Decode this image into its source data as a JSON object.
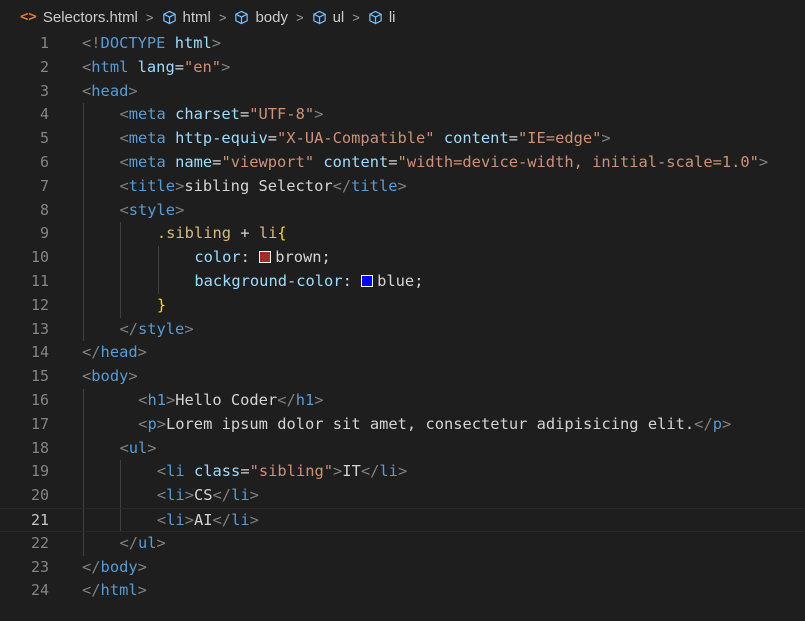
{
  "breadcrumb": {
    "file": "Selectors.html",
    "items": [
      "html",
      "body",
      "ul",
      "li"
    ]
  },
  "editor": {
    "current_line": 21,
    "lines": [
      {
        "n": "1",
        "indent": 0,
        "tokens": [
          [
            "br",
            "<!"
          ],
          [
            "tag",
            "DOCTYPE"
          ],
          [
            "txt",
            " "
          ],
          [
            "attr",
            "html"
          ],
          [
            "br",
            ">"
          ]
        ]
      },
      {
        "n": "2",
        "indent": 0,
        "tokens": [
          [
            "br",
            "<"
          ],
          [
            "tag",
            "html"
          ],
          [
            "txt",
            " "
          ],
          [
            "attr",
            "lang"
          ],
          [
            "txt",
            "="
          ],
          [
            "str",
            "\"en\""
          ],
          [
            "br",
            ">"
          ]
        ]
      },
      {
        "n": "3",
        "indent": 0,
        "tokens": [
          [
            "br",
            "<"
          ],
          [
            "tag",
            "head"
          ],
          [
            "br",
            ">"
          ]
        ]
      },
      {
        "n": "4",
        "indent": 1,
        "tokens": [
          [
            "br",
            "<"
          ],
          [
            "tag",
            "meta"
          ],
          [
            "txt",
            " "
          ],
          [
            "attr",
            "charset"
          ],
          [
            "txt",
            "="
          ],
          [
            "str",
            "\"UTF-8\""
          ],
          [
            "br",
            ">"
          ]
        ]
      },
      {
        "n": "5",
        "indent": 1,
        "tokens": [
          [
            "br",
            "<"
          ],
          [
            "tag",
            "meta"
          ],
          [
            "txt",
            " "
          ],
          [
            "attr",
            "http-equiv"
          ],
          [
            "txt",
            "="
          ],
          [
            "str",
            "\"X-UA-Compatible\""
          ],
          [
            "txt",
            " "
          ],
          [
            "attr",
            "content"
          ],
          [
            "txt",
            "="
          ],
          [
            "str",
            "\"IE=edge\""
          ],
          [
            "br",
            ">"
          ]
        ]
      },
      {
        "n": "6",
        "indent": 1,
        "tokens": [
          [
            "br",
            "<"
          ],
          [
            "tag",
            "meta"
          ],
          [
            "txt",
            " "
          ],
          [
            "attr",
            "name"
          ],
          [
            "txt",
            "="
          ],
          [
            "str",
            "\"viewport\""
          ],
          [
            "txt",
            " "
          ],
          [
            "attr",
            "content"
          ],
          [
            "txt",
            "="
          ],
          [
            "str",
            "\"width=device-width, initial-scale=1.0\""
          ],
          [
            "br",
            ">"
          ]
        ]
      },
      {
        "n": "7",
        "indent": 1,
        "tokens": [
          [
            "br",
            "<"
          ],
          [
            "tag",
            "title"
          ],
          [
            "br",
            ">"
          ],
          [
            "txt",
            "sibling Selector"
          ],
          [
            "br",
            "</"
          ],
          [
            "tag",
            "title"
          ],
          [
            "br",
            ">"
          ]
        ]
      },
      {
        "n": "8",
        "indent": 1,
        "tokens": [
          [
            "br",
            "<"
          ],
          [
            "tag",
            "style"
          ],
          [
            "br",
            ">"
          ]
        ]
      },
      {
        "n": "9",
        "indent": 2,
        "tokens": [
          [
            "sel",
            ".sibling"
          ],
          [
            "txt",
            " + "
          ],
          [
            "sel",
            "li"
          ],
          [
            "brace",
            "{"
          ]
        ]
      },
      {
        "n": "10",
        "indent": 3,
        "tokens": [
          [
            "prop",
            "color"
          ],
          [
            "txt",
            ": "
          ],
          [
            "swatch",
            "#a52a2a"
          ],
          [
            "txt",
            "brown;"
          ]
        ]
      },
      {
        "n": "11",
        "indent": 3,
        "tokens": [
          [
            "prop",
            "background-color"
          ],
          [
            "txt",
            ": "
          ],
          [
            "swatch",
            "#0000ff"
          ],
          [
            "txt",
            "blue;"
          ]
        ]
      },
      {
        "n": "12",
        "indent": 2,
        "tokens": [
          [
            "brace",
            "}"
          ]
        ]
      },
      {
        "n": "13",
        "indent": 1,
        "tokens": [
          [
            "br",
            "</"
          ],
          [
            "tag",
            "style"
          ],
          [
            "br",
            ">"
          ]
        ]
      },
      {
        "n": "14",
        "indent": 0,
        "tokens": [
          [
            "br",
            "</"
          ],
          [
            "tag",
            "head"
          ],
          [
            "br",
            ">"
          ]
        ]
      },
      {
        "n": "15",
        "indent": 0,
        "tokens": [
          [
            "br",
            "<"
          ],
          [
            "tag",
            "body"
          ],
          [
            "br",
            ">"
          ]
        ]
      },
      {
        "n": "16",
        "indent": 1.5,
        "tokens": [
          [
            "br",
            "<"
          ],
          [
            "tag",
            "h1"
          ],
          [
            "br",
            ">"
          ],
          [
            "txt",
            "Hello Coder"
          ],
          [
            "br",
            "</"
          ],
          [
            "tag",
            "h1"
          ],
          [
            "br",
            ">"
          ]
        ]
      },
      {
        "n": "17",
        "indent": 1.5,
        "tokens": [
          [
            "br",
            "<"
          ],
          [
            "tag",
            "p"
          ],
          [
            "br",
            ">"
          ],
          [
            "txt",
            "Lorem ipsum dolor sit amet, consectetur adipisicing elit."
          ],
          [
            "br",
            "</"
          ],
          [
            "tag",
            "p"
          ],
          [
            "br",
            ">"
          ]
        ]
      },
      {
        "n": "18",
        "indent": 1,
        "tokens": [
          [
            "br",
            "<"
          ],
          [
            "tag",
            "ul"
          ],
          [
            "br",
            ">"
          ]
        ]
      },
      {
        "n": "19",
        "indent": 2,
        "tokens": [
          [
            "br",
            "<"
          ],
          [
            "tag",
            "li"
          ],
          [
            "txt",
            " "
          ],
          [
            "attr",
            "class"
          ],
          [
            "txt",
            "="
          ],
          [
            "str",
            "\"sibling\""
          ],
          [
            "br",
            ">"
          ],
          [
            "txt",
            "IT"
          ],
          [
            "br",
            "</"
          ],
          [
            "tag",
            "li"
          ],
          [
            "br",
            ">"
          ]
        ]
      },
      {
        "n": "20",
        "indent": 2,
        "tokens": [
          [
            "br",
            "<"
          ],
          [
            "tag",
            "li"
          ],
          [
            "br",
            ">"
          ],
          [
            "txt",
            "CS"
          ],
          [
            "br",
            "</"
          ],
          [
            "tag",
            "li"
          ],
          [
            "br",
            ">"
          ]
        ]
      },
      {
        "n": "21",
        "indent": 2,
        "tokens": [
          [
            "br",
            "<"
          ],
          [
            "tag",
            "li"
          ],
          [
            "br",
            ">"
          ],
          [
            "txt",
            "AI"
          ],
          [
            "br",
            "</"
          ],
          [
            "tag",
            "li"
          ],
          [
            "br",
            ">"
          ]
        ]
      },
      {
        "n": "22",
        "indent": 1,
        "tokens": [
          [
            "br",
            "</"
          ],
          [
            "tag",
            "ul"
          ],
          [
            "br",
            ">"
          ]
        ]
      },
      {
        "n": "23",
        "indent": 0,
        "tokens": [
          [
            "br",
            "</"
          ],
          [
            "tag",
            "body"
          ],
          [
            "br",
            ">"
          ]
        ]
      },
      {
        "n": "24",
        "indent": 0,
        "tokens": [
          [
            "br",
            "</"
          ],
          [
            "tag",
            "html"
          ],
          [
            "br",
            ">"
          ]
        ]
      }
    ]
  }
}
